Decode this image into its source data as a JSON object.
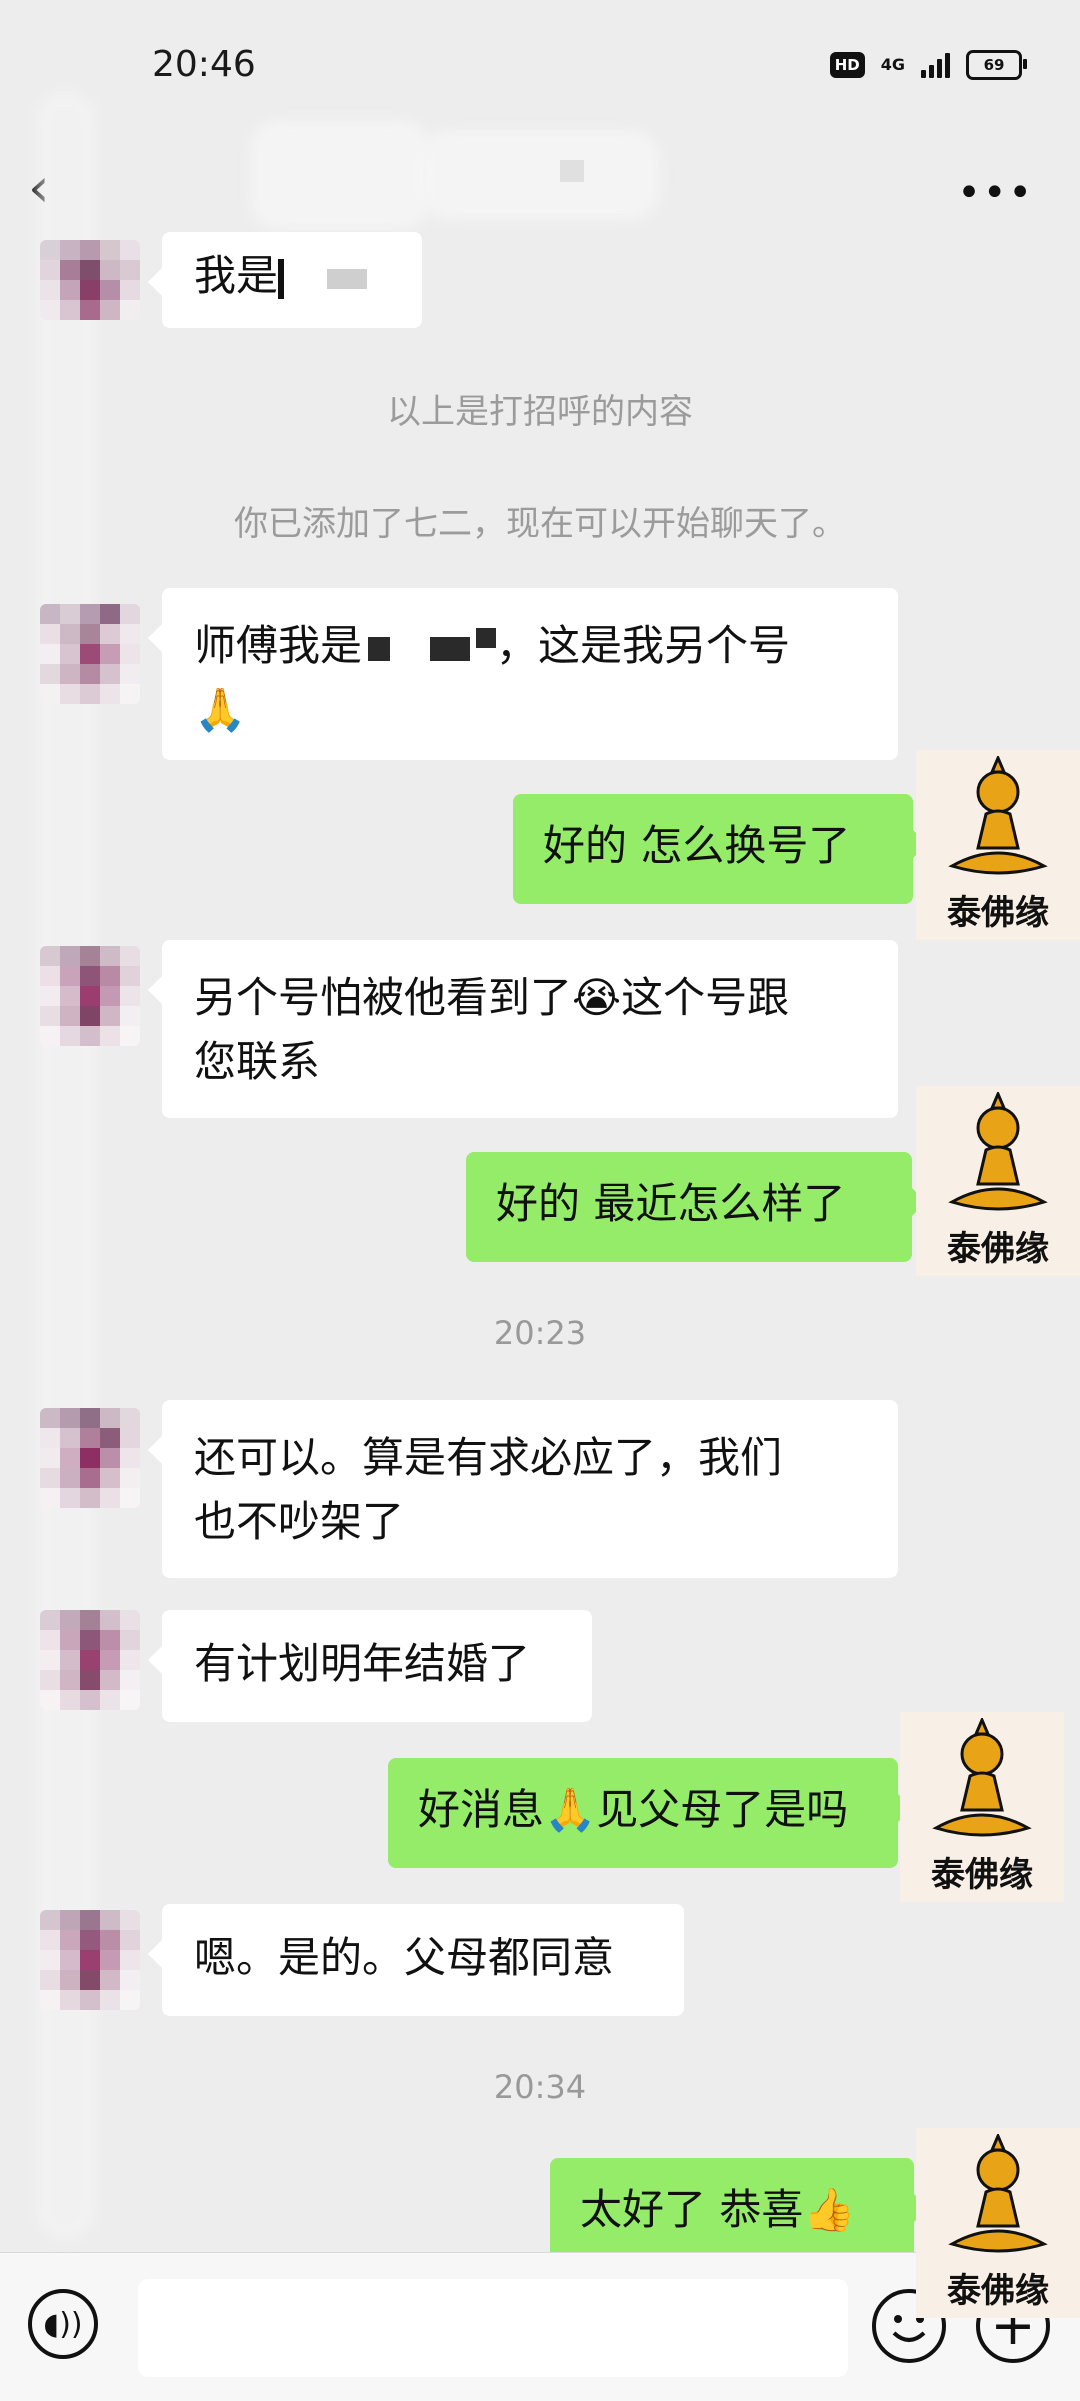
{
  "status_bar": {
    "time": "20:46",
    "hd": "HD",
    "network": "4G",
    "battery": "69"
  },
  "header": {
    "title": ""
  },
  "brand": {
    "logo_text": "泰佛缘",
    "logo_color": "#e8a317"
  },
  "colors": {
    "my_bubble": "#95ec69",
    "their_bubble": "#ffffff",
    "background": "#ededed"
  },
  "messages": {
    "m0": {
      "text": "我是"
    },
    "sys1": {
      "text": "以上是打招呼的内容"
    },
    "sys2": {
      "text": "你已添加了七二，现在可以开始聊天了。"
    },
    "m1": {
      "line1_a": "师傅我是",
      "line1_b": "，这是我另个号",
      "line2": "🙏"
    },
    "m2": {
      "text": "好的  怎么换号了"
    },
    "m3": {
      "line1": "另个号怕被他看到了😭这个号跟",
      "line2": "您联系"
    },
    "m4": {
      "text": "好的  最近怎么样了"
    },
    "t1": {
      "text": "20:23"
    },
    "m5": {
      "line1": "还可以。算是有求必应了，我们",
      "line2": "也不吵架了"
    },
    "m6": {
      "text": "有计划明年结婚了"
    },
    "m7": {
      "text": "好消息🙏见父母了是吗"
    },
    "m8": {
      "text": "嗯。是的。父母都同意"
    },
    "t2": {
      "text": "20:34"
    },
    "m9": {
      "text": "太好了  恭喜👍"
    }
  },
  "input_bar": {
    "voice_icon": "voice-icon",
    "emoji_icon": "emoji-icon",
    "plus_icon": "plus-icon"
  }
}
